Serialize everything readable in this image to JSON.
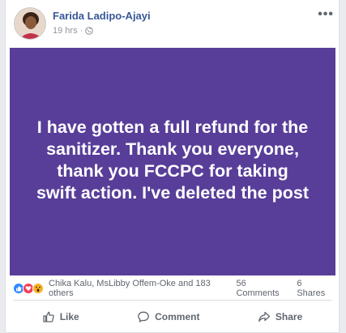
{
  "post": {
    "author": "Farida Ladipo-Ajayi",
    "time": "19 hrs",
    "separator": "·",
    "more_label": "•••",
    "privacy_icon": "globe-icon",
    "text": "I have gotten a full refund for the sanitizer. Thank you everyone, thank you FCCPC for taking swift action. I've deleted the post",
    "background_color": "#583e99"
  },
  "stats": {
    "reactions": [
      "like-icon",
      "love-icon",
      "wow-icon"
    ],
    "reactors": "Chika Kalu, MsLibby Offem-Oke and 183 others",
    "comments": "56 Comments",
    "shares": "6 Shares"
  },
  "actions": {
    "like": "Like",
    "comment": "Comment",
    "share": "Share"
  }
}
